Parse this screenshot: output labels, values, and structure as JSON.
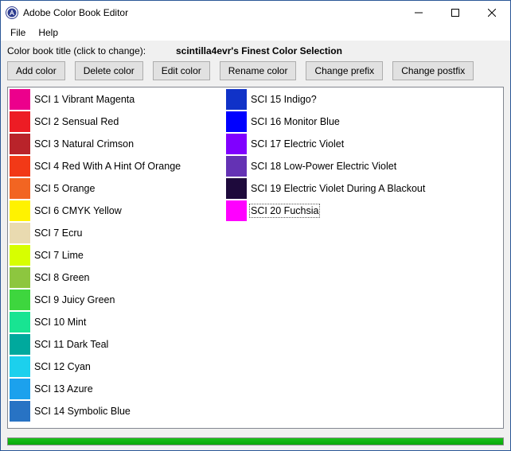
{
  "window": {
    "title": "Adobe Color Book Editor",
    "icon_name": "app-icon"
  },
  "menu": {
    "file": "File",
    "help": "Help"
  },
  "header": {
    "label": "Color book title (click to change):",
    "value": "scintilla4evr's Finest Color Selection"
  },
  "toolbar": {
    "add": "Add color",
    "delete": "Delete color",
    "edit": "Edit color",
    "rename": "Rename color",
    "prefix": "Change prefix",
    "postfix": "Change postfix"
  },
  "colors": [
    {
      "label": "SCI 1 Vibrant Magenta",
      "hex": "#ec008c"
    },
    {
      "label": "SCI 2 Sensual Red",
      "hex": "#ed1c24"
    },
    {
      "label": "SCI 3 Natural Crimson",
      "hex": "#b9232a"
    },
    {
      "label": "SCI 4 Red With A Hint Of Orange",
      "hex": "#f23917"
    },
    {
      "label": "SCI 5 Orange",
      "hex": "#f26522"
    },
    {
      "label": "SCI 6 CMYK Yellow",
      "hex": "#fff200"
    },
    {
      "label": "SCI 7 Ecru",
      "hex": "#e9dab0"
    },
    {
      "label": "SCI 7 Lime",
      "hex": "#d7ff00"
    },
    {
      "label": "SCI 8 Green",
      "hex": "#8dc63f"
    },
    {
      "label": "SCI 9 Juicy Green",
      "hex": "#3ed63e"
    },
    {
      "label": "SCI 10 Mint",
      "hex": "#18e492"
    },
    {
      "label": "SCI 11 Dark Teal",
      "hex": "#00a99d"
    },
    {
      "label": "SCI 12 Cyan",
      "hex": "#1cd0ed"
    },
    {
      "label": "SCI 13 Azure",
      "hex": "#1ca1ed"
    },
    {
      "label": "SCI 14 Symbolic Blue",
      "hex": "#2873c4"
    },
    {
      "label": "SCI 15 Indigo?",
      "hex": "#1032c8"
    },
    {
      "label": "SCI 16 Monitor Blue",
      "hex": "#0000ff"
    },
    {
      "label": "SCI 17 Electric Violet",
      "hex": "#8000ff"
    },
    {
      "label": "SCI 18 Low-Power Electric Violet",
      "hex": "#6432b4"
    },
    {
      "label": "SCI 19 Electric Violet During A Blackout",
      "hex": "#1e0a3c"
    },
    {
      "label": "SCI 20 Fuchsia",
      "hex": "#ff00ff"
    }
  ],
  "selected_index": 20
}
